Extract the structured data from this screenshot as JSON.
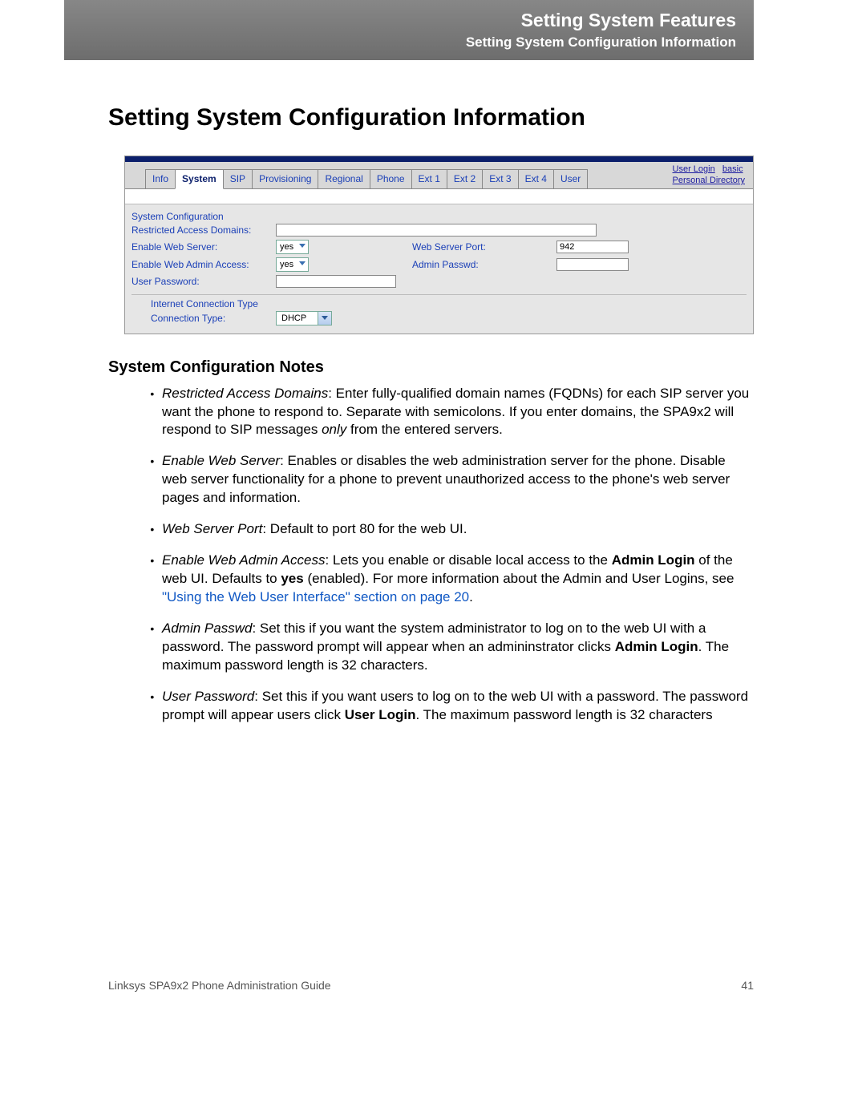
{
  "header": {
    "title": "Setting System Features",
    "subtitle": "Setting System Configuration Information"
  },
  "page_title": "Setting System Configuration Information",
  "screenshot": {
    "tabs": [
      "Info",
      "System",
      "SIP",
      "Provisioning",
      "Regional",
      "Phone",
      "Ext 1",
      "Ext 2",
      "Ext 3",
      "Ext 4",
      "User"
    ],
    "active_tab": "System",
    "top_links": {
      "user_login": "User Login",
      "basic": "basic",
      "personal_directory": "Personal Directory"
    },
    "section_title": "System Configuration",
    "fields": {
      "restricted_access_domains": {
        "label": "Restricted Access Domains:",
        "value": ""
      },
      "enable_web_server": {
        "label": "Enable Web Server:",
        "value": "yes"
      },
      "web_server_port": {
        "label": "Web Server Port:",
        "value": "942"
      },
      "enable_web_admin_access": {
        "label": "Enable Web Admin Access:",
        "value": "yes"
      },
      "admin_passwd": {
        "label": "Admin Passwd:",
        "value": ""
      },
      "user_password": {
        "label": "User Password:",
        "value": ""
      }
    },
    "subsection": {
      "title": "Internet Connection Type",
      "connection_type": {
        "label": "Connection Type:",
        "value": "DHCP"
      }
    }
  },
  "notes_heading": "System Configuration Notes",
  "notes": [
    {
      "term": "Restricted Access Domains",
      "text_before": ": Enter fully-qualified domain names (FQDNs) for each SIP server you want the phone to respond to. Separate with semicolons. If you enter domains, the SPA9x2 will respond to SIP messages ",
      "italic_word": "only",
      "text_after": " from the entered servers."
    },
    {
      "term": "Enable Web Server",
      "text": ": Enables or disables the web administration server for the phone. Disable web server functionality for a phone to prevent unauthorized access to the phone's web server pages and information."
    },
    {
      "term": "Web Server Port",
      "text": ": Default to port 80 for the web UI."
    },
    {
      "term": "Enable Web Admin Access",
      "text_before": ": Lets you enable or disable local access to the ",
      "bold": "Admin Login",
      "text_mid": " of the web UI. Defaults to ",
      "bold2": "yes",
      "text_mid2": " (enabled). For more information about the Admin and User Logins, see ",
      "link": "\"Using the Web User Interface\" section on page 20",
      "text_after": "."
    },
    {
      "term": "Admin Passwd",
      "text_before": ": Set this if you want the system administrator to log on to the web UI with a password. The password prompt will appear when an admininstrator clicks ",
      "bold": "Admin Login",
      "text_after": ". The maximum password length is 32 characters."
    },
    {
      "term": "User Password",
      "text_before": ": Set this if you want users to log on to the web UI with a password. The password prompt will appear users click ",
      "bold": "User Login",
      "text_after": ". The maximum password length is 32 characters"
    }
  ],
  "footer": {
    "left": "Linksys SPA9x2 Phone Administration Guide",
    "right": "41"
  }
}
